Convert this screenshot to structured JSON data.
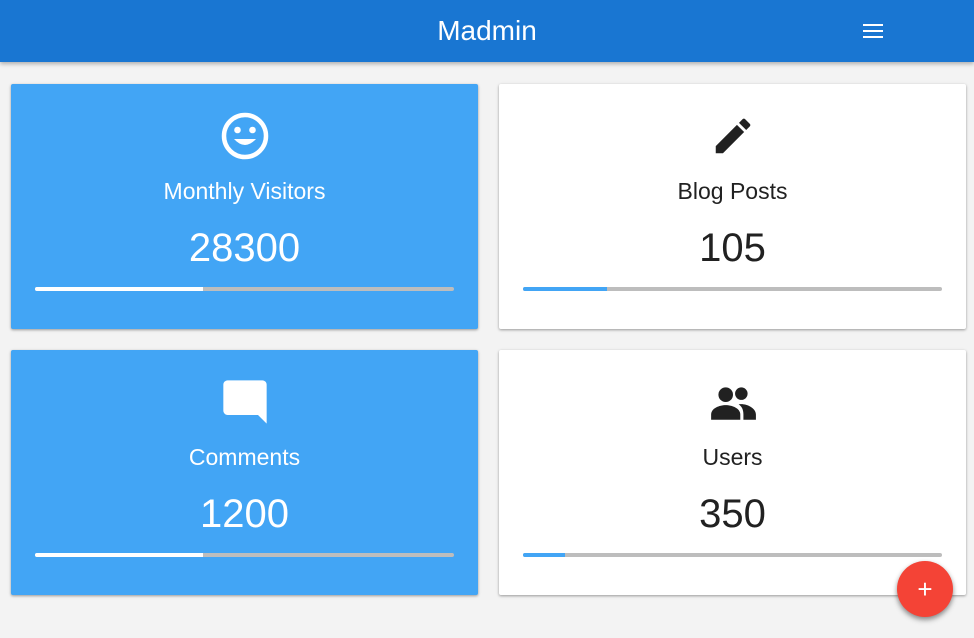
{
  "app": {
    "title": "Madmin",
    "menu_icon": "menu-icon"
  },
  "colors": {
    "appbar": "#1976d2",
    "card_blue": "#42a5f5",
    "card_white": "#ffffff",
    "progress_track": "#bdbdbd",
    "fab": "#f44336"
  },
  "cards": [
    {
      "title": "Monthly Visitors",
      "value": "28300",
      "icon": "smiley-face-icon",
      "style": "blue",
      "progress": 0.4
    },
    {
      "title": "Blog Posts",
      "value": "105",
      "icon": "pencil-icon",
      "style": "white",
      "progress": 0.2
    },
    {
      "title": "Comments",
      "value": "1200",
      "icon": "comment-icon",
      "style": "blue",
      "progress": 0.4
    },
    {
      "title": "Users",
      "value": "350",
      "icon": "people-icon",
      "style": "white",
      "progress": 0.1
    }
  ],
  "fab": {
    "label": "+",
    "icon": "add-icon"
  }
}
